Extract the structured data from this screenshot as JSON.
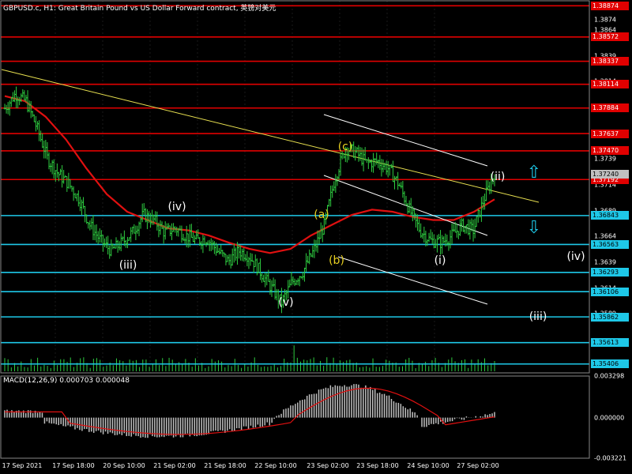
{
  "header": {
    "title": "GBPUSD.c, H1:  Great Britain Pound vs US Dollar Forward contract, 英镑对美元",
    "macd_label": "MACD(12,26,9) 0.000703 0.000048"
  },
  "colors": {
    "background": "#000000",
    "grid": "#1a1a1a",
    "bull_bar": "#2ecc40",
    "red_level": "#e00000",
    "cyan_level": "#1ec8e8",
    "ma_line": "#e01010",
    "trendline": "#e8e050",
    "channel": "#ffffff",
    "macd_hist": "#c0c0c0",
    "macd_signal": "#e01010",
    "label_white": "#ffffff",
    "label_yellow": "#e8d020"
  },
  "chart_data": [
    {
      "type": "candlestick",
      "symbol": "GBPUSD.c",
      "timeframe": "H1",
      "ylim": [
        1.3532,
        1.3893
      ],
      "y_ticks": [
        1.3874,
        1.3864,
        1.3839,
        1.3814,
        1.3789,
        1.3764,
        1.3739,
        1.3714,
        1.3689,
        1.3664,
        1.3639,
        1.3614,
        1.3589,
        1.3561,
        1.354
      ],
      "x_ticks": [
        "17 Sep 2021",
        "17 Sep 18:00",
        "20 Sep 10:00",
        "21 Sep 02:00",
        "21 Sep 18:00",
        "22 Sep 10:00",
        "23 Sep 02:00",
        "23 Sep 18:00",
        "24 Sep 10:00",
        "27 Sep 02:00"
      ],
      "close_path": [
        1.3788,
        1.3802,
        1.3795,
        1.377,
        1.374,
        1.3725,
        1.3715,
        1.37,
        1.3675,
        1.366,
        1.365,
        1.3658,
        1.3668,
        1.3685,
        1.368,
        1.3668,
        1.3672,
        1.3665,
        1.366,
        1.3662,
        1.365,
        1.364,
        1.365,
        1.3645,
        1.363,
        1.3615,
        1.36,
        1.362,
        1.363,
        1.365,
        1.3675,
        1.372,
        1.375,
        1.3745,
        1.3735,
        1.3737,
        1.373,
        1.3715,
        1.369,
        1.367,
        1.366,
        1.3658,
        1.3665,
        1.3675,
        1.367,
        1.37,
        1.3725
      ],
      "moving_average": [
        1.38,
        1.3795,
        1.378,
        1.3758,
        1.373,
        1.3705,
        1.3688,
        1.368,
        1.3672,
        1.367,
        1.3665,
        1.3658,
        1.3652,
        1.3648,
        1.3652,
        1.3665,
        1.3675,
        1.3685,
        1.369,
        1.3688,
        1.3683,
        1.368,
        1.368,
        1.3688,
        1.37
      ],
      "red_levels": [
        {
          "label": "1.38874"
        },
        {
          "label": "1.38572"
        },
        {
          "label": "1.38337"
        },
        {
          "label": "1.38114"
        },
        {
          "label": "1.37884"
        },
        {
          "label": "1.37637"
        },
        {
          "label": "1.37470"
        },
        {
          "label": "1.37192"
        }
      ],
      "cyan_levels": [
        {
          "label": "1.36843"
        },
        {
          "label": "1.36563"
        },
        {
          "label": "1.36293"
        },
        {
          "label": "1.36106"
        },
        {
          "label": "1.35862"
        },
        {
          "label": "1.35613"
        },
        {
          "label": "1.35406"
        }
      ],
      "current_price_label": "1.37240",
      "wave_labels": [
        {
          "text": "(iv)",
          "color": "white"
        },
        {
          "text": "(iii)",
          "color": "white"
        },
        {
          "text": "(v)",
          "color": "white"
        },
        {
          "text": "(a)",
          "color": "yellow"
        },
        {
          "text": "(b)",
          "color": "yellow"
        },
        {
          "text": "(c)",
          "color": "yellow"
        },
        {
          "text": "(i)",
          "color": "white"
        },
        {
          "text": "(ii)",
          "color": "white"
        },
        {
          "text": "(iv)",
          "color": "white"
        },
        {
          "text": "(iii)",
          "color": "white"
        }
      ]
    },
    {
      "type": "histogram",
      "name": "MACD(12,26,9)",
      "ylim": [
        -0.003221,
        0.003298
      ],
      "y_ticks": [
        "0.003298",
        "0.000000",
        "-0.003221"
      ]
    }
  ]
}
